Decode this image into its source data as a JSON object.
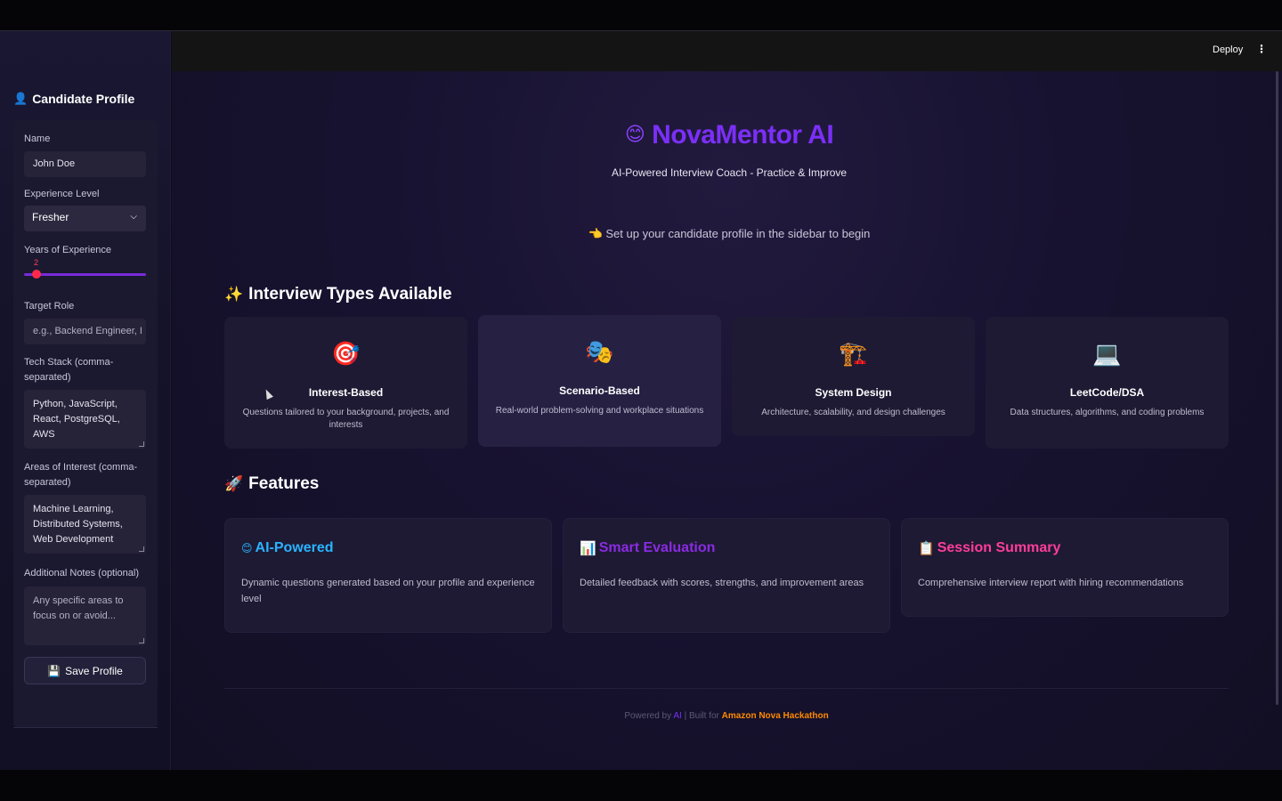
{
  "sidebar": {
    "title": "Candidate Profile",
    "title_icon": "👤",
    "name": {
      "label": "Name",
      "value": "John Doe"
    },
    "experience_level": {
      "label": "Experience Level",
      "value": "Fresher"
    },
    "years": {
      "label": "Years of Experience",
      "value": "2",
      "fraction": 0.07
    },
    "target_role": {
      "label": "Target Role",
      "placeholder": "e.g., Backend Engineer, I"
    },
    "tech_stack": {
      "label": "Tech Stack (comma-separated)",
      "value": "Python, JavaScript, React, PostgreSQL, AWS"
    },
    "interests": {
      "label": "Areas of Interest (comma-separated)",
      "value": "Machine Learning, Distributed Systems, Web Development"
    },
    "notes": {
      "label": "Additional Notes (optional)",
      "placeholder": "Any specific areas to focus on or avoid..."
    },
    "save_icon": "💾",
    "save_label": "Save Profile"
  },
  "header": {
    "deploy": "Deploy",
    "menu_icon": "⋮"
  },
  "hero": {
    "icon": "😊",
    "title": "NovaMentor AI",
    "subtitle": "AI-Powered Interview Coach - Practice & Improve",
    "hint_icon": "👈",
    "hint": "Set up your candidate profile in the sidebar to begin"
  },
  "interview_types": {
    "icon": "✨",
    "title": "Interview Types Available",
    "cards": [
      {
        "icon": "🎯",
        "title": "Interest-Based",
        "desc": "Questions tailored to your background, projects, and interests"
      },
      {
        "icon": "🎭",
        "title": "Scenario-Based",
        "desc": "Real-world problem-solving and workplace situations"
      },
      {
        "icon": "🏗️",
        "title": "System Design",
        "desc": "Architecture, scalability, and design challenges"
      },
      {
        "icon": "💻",
        "title": "LeetCode/DSA",
        "desc": "Data structures, algorithms, and coding problems"
      }
    ]
  },
  "features": {
    "icon": "🚀",
    "title": "Features",
    "items": [
      {
        "icon": "😊",
        "title": "AI-Powered",
        "color": "#2ab3ff",
        "desc": "Dynamic questions generated based on your profile and experience level"
      },
      {
        "icon": "📊",
        "title": "Smart Evaluation",
        "color": "#8a2be2",
        "desc": "Detailed feedback with scores, strengths, and improvement areas"
      },
      {
        "icon": "📋",
        "title": "Session Summary",
        "color": "#ff3d9a",
        "desc": "Comprehensive interview report with hiring recommendations"
      }
    ]
  },
  "footer": {
    "prefix": "Powered by",
    "ai": "AI",
    "mid": "| Built for",
    "event": "Amazon Nova Hackathon"
  }
}
